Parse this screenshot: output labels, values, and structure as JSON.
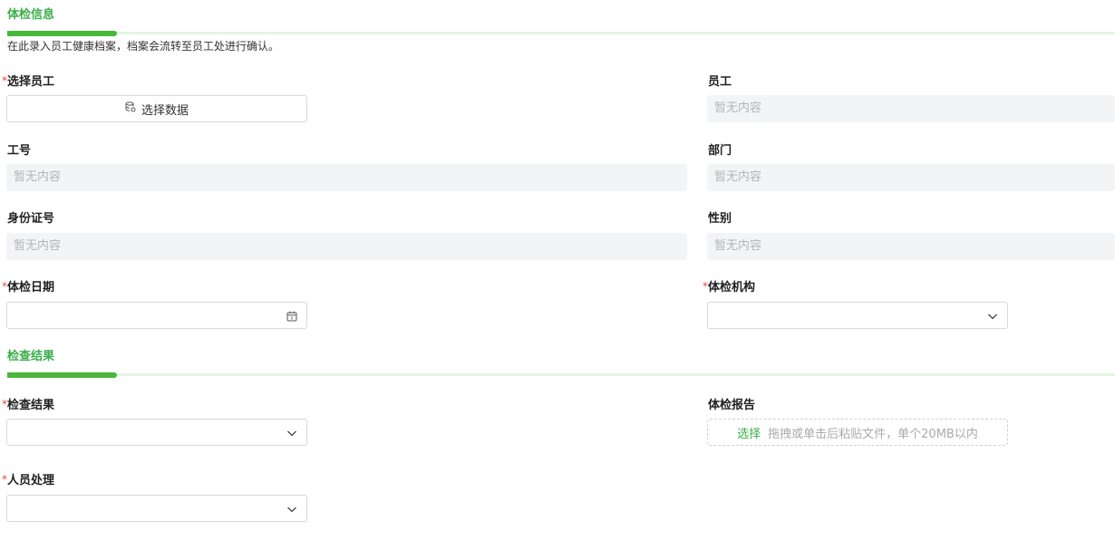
{
  "sections": {
    "exam_info": {
      "title": "体检信息",
      "description": "在此录入员工健康档案，档案会流转至员工处进行确认。"
    },
    "results": {
      "title": "检查结果"
    }
  },
  "fields": {
    "select_employee": {
      "label": "选择员工",
      "required": true,
      "button_label": "选择数据",
      "icon": "database-icon"
    },
    "employee": {
      "label": "员工",
      "value": "暂无内容"
    },
    "job_no": {
      "label": "工号",
      "value": "暂无内容"
    },
    "department": {
      "label": "部门",
      "value": "暂无内容"
    },
    "id_number": {
      "label": "身份证号",
      "value": "暂无内容"
    },
    "gender": {
      "label": "性别",
      "value": "暂无内容"
    },
    "exam_date": {
      "label": "体检日期",
      "required": true,
      "value": "",
      "icon": "calendar-icon"
    },
    "exam_org": {
      "label": "体检机构",
      "required": true,
      "value": "",
      "icon": "chevron-down-icon"
    },
    "check_result": {
      "label": "检查结果",
      "required": true,
      "value": "",
      "icon": "chevron-down-icon"
    },
    "exam_report": {
      "label": "体检报告",
      "select_label": "选择",
      "hint": "拖拽或单击后粘贴文件，单个20MB以内"
    },
    "personnel_action": {
      "label": "人员处理",
      "required": true,
      "value": "",
      "icon": "chevron-down-icon"
    }
  },
  "colors": {
    "accent": "#3aae49",
    "required": "#e5484d",
    "readonly_bg": "#f3f4f6",
    "placeholder": "#b5b5b5"
  }
}
